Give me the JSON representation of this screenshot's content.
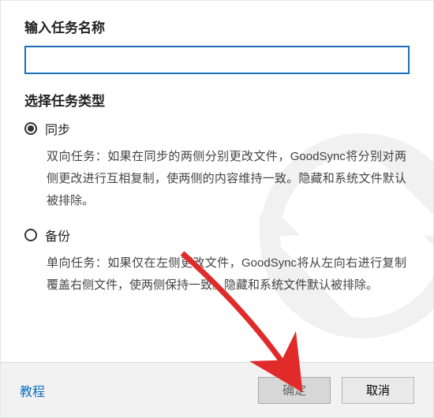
{
  "section": {
    "input_title": "输入任务名称",
    "type_title": "选择任务类型"
  },
  "input": {
    "value": ""
  },
  "options": {
    "sync": {
      "label": "同步",
      "desc": "双向任务：如果在同步的两侧分别更改文件，GoodSync将分别对两侧更改进行互相复制，使两侧的内容维持一致。隐藏和系统文件默认被排除。"
    },
    "backup": {
      "label": "备份",
      "desc": "单向任务：如果仅在左侧更改文件，GoodSync将从左向右进行复制覆盖右侧文件，使两侧保持一致。隐藏和系统文件默认被排除。"
    }
  },
  "footer": {
    "tutorial": "教程",
    "ok": "确定",
    "cancel": "取消"
  }
}
